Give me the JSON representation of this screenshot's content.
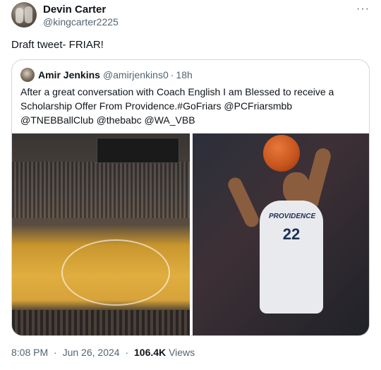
{
  "tweet": {
    "author_name": "Devin Carter",
    "author_handle": "@kingcarter2225",
    "more_label": "···",
    "text": "Draft tweet- FRIAR!"
  },
  "quote": {
    "author_name": "Amir Jenkins",
    "author_handle": "@amirjenkins0",
    "separator": "·",
    "time": "18h",
    "text": "After a great conversation with Coach English I am Blessed to receive a Scholarship Offer From Providence.#GoFriars @PCFriarsmbb @TNEBBallClub @thebabc @WA_VBB",
    "images": {
      "left": "arena-court-photo",
      "right": "player-shooting-photo",
      "jersey_team": "PROVIDENCE",
      "jersey_number": "22"
    }
  },
  "footer": {
    "time": "8:08 PM",
    "separator": "·",
    "date": "Jun 26, 2024",
    "views_count": "106.4K",
    "views_label": "Views"
  }
}
